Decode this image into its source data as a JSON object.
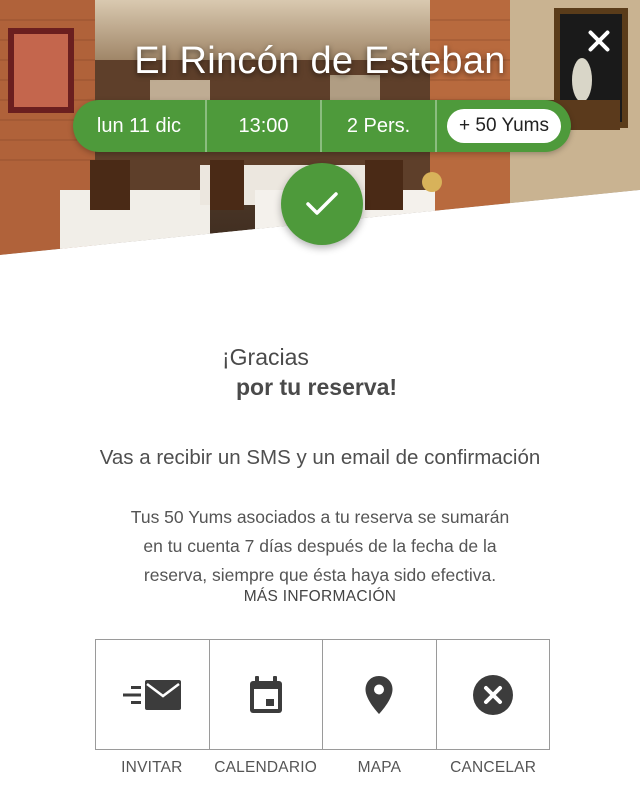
{
  "restaurant": {
    "name": "El Rincón de Esteban"
  },
  "booking": {
    "date": "lun 11 dic",
    "time": "13:00",
    "people": "2 Pers.",
    "yums": "+ 50 Yums"
  },
  "icons": {
    "close": "close-icon",
    "confirmed": "check-icon",
    "invite": "send-mail-icon",
    "calendar": "calendar-icon",
    "map": "map-pin-icon",
    "cancel": "cancel-circle-icon"
  },
  "confirmation": {
    "thanks_line1": "¡Gracias",
    "thanks_line2": "por tu reserva!",
    "sms_notice": "Vas a recibir un SMS y un email de confirmación",
    "yums_info_line1": "Tus 50 Yums asociados a tu reserva se sumarán",
    "yums_info_line2": "en tu cuenta 7 días después de la fecha de la",
    "yums_info_line3": "reserva, siempre que ésta haya sido efectiva.",
    "more_info": "MÁS INFORMACIÓN"
  },
  "actions": {
    "invite": "INVITAR",
    "calendar": "CALENDARIO",
    "map": "MAPA",
    "cancel": "CANCELAR"
  },
  "colors": {
    "accent_green": "#4e9a3b",
    "icon_dark": "#3c3c3c",
    "text": "#4a4a4a",
    "border": "#9a9a9a"
  }
}
